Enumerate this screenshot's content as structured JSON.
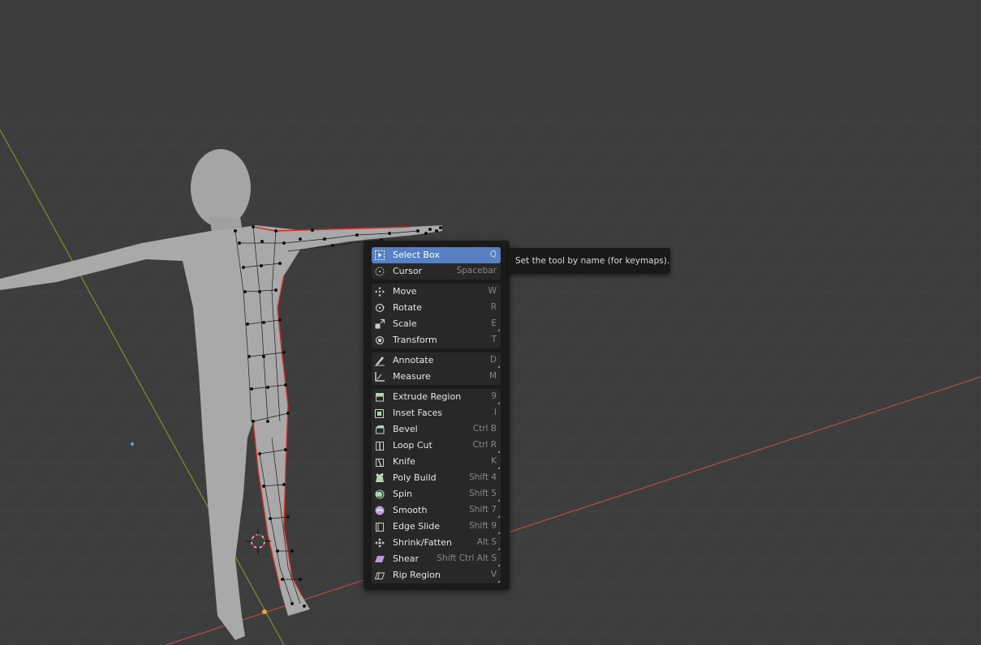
{
  "viewport": {
    "background": "#3d3d3d",
    "axis_x_color": "#b84b4b",
    "axis_y_color": "#6f9a2a",
    "edge_selected_color": "#d42b1f",
    "vertex_color": "#000000"
  },
  "tool_menu": {
    "items": [
      {
        "label": "Select Box",
        "shortcut": "Q",
        "icon": "select-box-icon",
        "active": true
      },
      {
        "label": "Cursor",
        "shortcut": "Spacebar",
        "icon": "cursor-icon"
      },
      {
        "label": "Move",
        "shortcut": "W",
        "icon": "move-icon"
      },
      {
        "label": "Rotate",
        "shortcut": "R",
        "icon": "rotate-icon"
      },
      {
        "label": "Scale",
        "shortcut": "E",
        "icon": "scale-icon",
        "has_more": true
      },
      {
        "label": "Transform",
        "shortcut": "T",
        "icon": "transform-icon"
      },
      {
        "label": "Annotate",
        "shortcut": "D",
        "icon": "annotate-icon",
        "has_more": true
      },
      {
        "label": "Measure",
        "shortcut": "M",
        "icon": "measure-icon"
      },
      {
        "label": "Extrude Region",
        "shortcut": "9",
        "icon": "extrude-region-icon",
        "has_more": true
      },
      {
        "label": "Inset Faces",
        "shortcut": "I",
        "icon": "inset-faces-icon"
      },
      {
        "label": "Bevel",
        "shortcut": "Ctrl B",
        "icon": "bevel-icon"
      },
      {
        "label": "Loop Cut",
        "shortcut": "Ctrl R",
        "icon": "loop-cut-icon",
        "has_more": true
      },
      {
        "label": "Knife",
        "shortcut": "K",
        "icon": "knife-icon",
        "has_more": true
      },
      {
        "label": "Poly Build",
        "shortcut": "Shift 4",
        "icon": "poly-build-icon"
      },
      {
        "label": "Spin",
        "shortcut": "Shift 5",
        "icon": "spin-icon",
        "has_more": true
      },
      {
        "label": "Smooth",
        "shortcut": "Shift 7",
        "icon": "smooth-icon",
        "has_more": true
      },
      {
        "label": "Edge Slide",
        "shortcut": "Shift 9",
        "icon": "edge-slide-icon",
        "has_more": true
      },
      {
        "label": "Shrink/Fatten",
        "shortcut": "Alt S",
        "icon": "shrink-fatten-icon",
        "has_more": true
      },
      {
        "label": "Shear",
        "shortcut": "Shift Ctrl Alt S",
        "icon": "shear-icon",
        "has_more": true
      },
      {
        "label": "Rip Region",
        "shortcut": "V",
        "icon": "rip-region-icon",
        "has_more": true
      }
    ]
  },
  "tooltip": {
    "text": "Set the tool by name (for keymaps)."
  },
  "colors": {
    "menu_bg": "#1b1b1b",
    "item_bg": "#282828",
    "highlight": "#5680c2",
    "icon_green": "#a8d9b0",
    "icon_purple": "#b39ddb"
  }
}
